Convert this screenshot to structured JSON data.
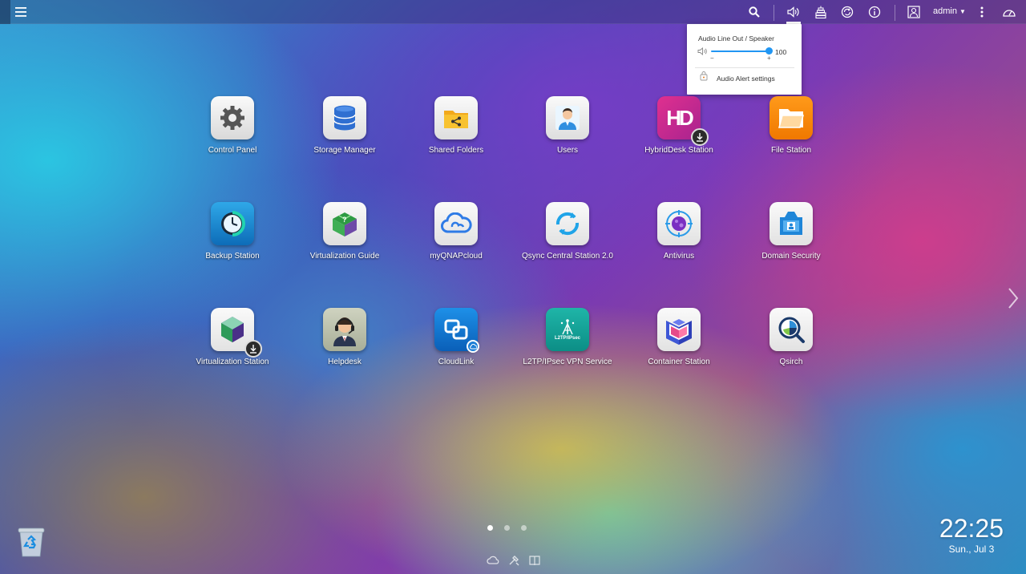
{
  "topbar": {
    "user": "admin"
  },
  "volume_popup": {
    "title": "Audio Line Out / Speaker",
    "volume": "100",
    "minus": "−",
    "plus": "+",
    "alert_settings": "Audio Alert settings"
  },
  "apps": [
    {
      "label": "Control Panel"
    },
    {
      "label": "Storage Manager"
    },
    {
      "label": "Shared Folders"
    },
    {
      "label": "Users"
    },
    {
      "label": "HybridDesk Station"
    },
    {
      "label": "File Station"
    },
    {
      "label": "Backup Station"
    },
    {
      "label": "Virtualization Guide"
    },
    {
      "label": "myQNAPcloud"
    },
    {
      "label": "Qsync Central Station 2.0"
    },
    {
      "label": "Antivirus"
    },
    {
      "label": "Domain Security"
    },
    {
      "label": "Virtualization Station"
    },
    {
      "label": "Helpdesk"
    },
    {
      "label": "CloudLink"
    },
    {
      "label": "L2TP/IPsec VPN Service"
    },
    {
      "label": "Container Station"
    },
    {
      "label": "Qsirch"
    }
  ],
  "icon_text": {
    "hd": "HD",
    "l2tp": "L2TP/IPsec"
  },
  "clock": {
    "time": "22:25",
    "date": "Sun., Jul 3"
  },
  "colors": {
    "accent": "#2196f3"
  }
}
